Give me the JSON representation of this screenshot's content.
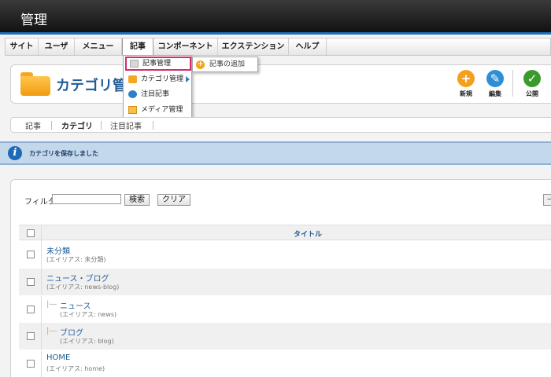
{
  "header": {
    "title": "管理"
  },
  "menu": {
    "items": [
      {
        "label": "サイト"
      },
      {
        "label": "ユーザ"
      },
      {
        "label": "メニュー"
      },
      {
        "label": "記事"
      },
      {
        "label": "コンポーネント"
      },
      {
        "label": "エクステンション"
      },
      {
        "label": "ヘルプ"
      }
    ],
    "active_index": 3
  },
  "dropdown": {
    "items": [
      {
        "label": "記事管理",
        "icon": "article-icon"
      },
      {
        "label": "カテゴリ管理",
        "icon": "category-icon"
      },
      {
        "label": "注目記事",
        "icon": "featured-icon"
      },
      {
        "label": "メディア管理",
        "icon": "media-icon"
      }
    ],
    "highlighted_index": 0,
    "submenu": {
      "label": "記事の追加",
      "icon": "add-icon"
    }
  },
  "toolbar": {
    "page_title": "カテゴリ管",
    "buttons": [
      {
        "label": "新規",
        "icon": "new-icon",
        "color": "#f5a01c"
      },
      {
        "label": "編集",
        "icon": "edit-icon",
        "color": "#2d8fd6"
      },
      {
        "label": "公開",
        "icon": "publish-icon",
        "color": "#3a9a2e"
      }
    ]
  },
  "subnav": {
    "items": [
      {
        "label": "記事"
      },
      {
        "label": "カテゴリ"
      },
      {
        "label": "注目記事"
      }
    ],
    "current_index": 1
  },
  "message": {
    "text": "カテゴリを保存しました"
  },
  "filter": {
    "label": "フィルタ:",
    "value": "",
    "search_label": "検索",
    "clear_label": "クリア",
    "right_control": "—"
  },
  "table": {
    "column_title": "タイトル",
    "rows": [
      {
        "title": "未分類",
        "alias": "(エイリアス: 未分類)",
        "level": 0
      },
      {
        "title": "ニュース・ブログ",
        "alias": "(エイリアス: news-blog)",
        "level": 0
      },
      {
        "title": "ニュース",
        "alias": "(エイリアス: news)",
        "level": 1,
        "tree": "|—"
      },
      {
        "title": "ブログ",
        "alias": "(エイリアス: blog)",
        "level": 1,
        "tree": "|—"
      },
      {
        "title": "HOME",
        "alias": "(エイリアス: home)",
        "level": 0
      }
    ]
  },
  "colors": {
    "header_bg": "#1a1a1a",
    "link": "#1f5c96",
    "message_bg": "#c4d8ec",
    "highlight_border": "#d42b6a"
  }
}
